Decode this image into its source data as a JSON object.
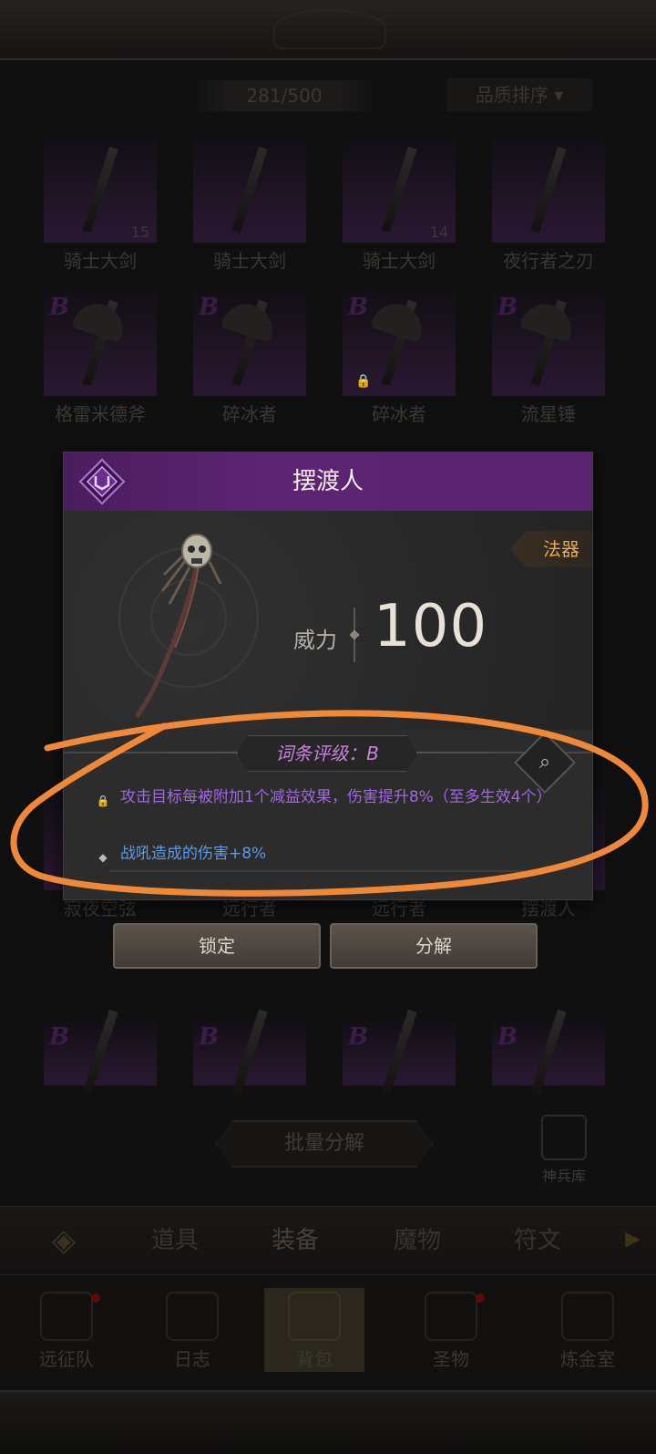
{
  "inventory": {
    "capacity": "281/500",
    "sort_label": "品质排序",
    "rows": [
      [
        {
          "rank": "",
          "name": "骑士大剑",
          "count": "15",
          "locked": false
        },
        {
          "rank": "",
          "name": "骑士大剑",
          "count": "",
          "locked": false
        },
        {
          "rank": "",
          "name": "骑士大剑",
          "count": "14",
          "locked": false
        },
        {
          "rank": "",
          "name": "夜行者之刃",
          "count": "",
          "locked": false
        }
      ],
      [
        {
          "rank": "B",
          "name": "格雷米德斧",
          "count": "",
          "locked": false
        },
        {
          "rank": "B",
          "name": "碎冰者",
          "count": "",
          "locked": false
        },
        {
          "rank": "B",
          "name": "碎冰者",
          "count": "",
          "locked": true
        },
        {
          "rank": "B",
          "name": "流星锤",
          "count": "",
          "locked": false
        }
      ],
      [
        {
          "rank": "",
          "name": "寂夜空弦",
          "count": "",
          "locked": false
        },
        {
          "rank": "",
          "name": "远行者",
          "count": "",
          "locked": false
        },
        {
          "rank": "",
          "name": "远行者",
          "count": "",
          "locked": false
        },
        {
          "rank": "",
          "name": "摆渡人",
          "count": "",
          "locked": false
        }
      ],
      [
        {
          "rank": "B",
          "name": "",
          "count": "",
          "locked": false
        },
        {
          "rank": "B",
          "name": "",
          "count": "",
          "locked": false
        },
        {
          "rank": "B",
          "name": "",
          "count": "",
          "locked": false
        },
        {
          "rank": "B",
          "name": "",
          "count": "",
          "locked": false
        }
      ]
    ]
  },
  "mass_decompose_label": "批量分解",
  "armory_label": "神兵库",
  "tabs": [
    "道具",
    "装备",
    "魔物",
    "符文"
  ],
  "nav": [
    "远征队",
    "日志",
    "背包",
    "圣物",
    "炼金室"
  ],
  "popup": {
    "title": "摆渡人",
    "category": "法器",
    "power_label": "威力",
    "power_value": "100",
    "grade_label": "词条评级：B",
    "affixes": [
      {
        "text": "攻击目标每被附加1个减益效果，伤害提升8%（至多生效4个）",
        "type": "locked"
      },
      {
        "text": "战吼造成的伤害+8%",
        "type": "normal"
      }
    ],
    "lock_button": "锁定",
    "decompose_button": "分解"
  },
  "colors": {
    "header_purple": "#5e2474",
    "affix_purple": "#a067e0",
    "affix_blue": "#5c9ae8",
    "category_orange": "#e8a94a",
    "annotation_orange": "#f0883a"
  }
}
